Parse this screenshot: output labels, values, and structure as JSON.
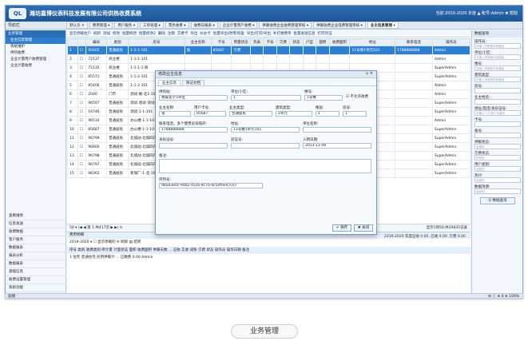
{
  "app": {
    "logo_text": "QL",
    "title": "潍坊嘉博仪表科技发展有限公司供热收费系统",
    "user_info": "当前:2019-2020 年度  ▲ 帐号:Admin  ✖ 帮助"
  },
  "menubar": {
    "left_label": "导航栏",
    "tabs": [
      {
        "label": "默认页 ✕"
      },
      {
        "label": "费用管理 ▾"
      },
      {
        "label": "用户服务 ▾"
      },
      {
        "label": "工单处理 ▾"
      },
      {
        "label": "票务收费 ▾"
      },
      {
        "label": "收费日报表 ▾"
      },
      {
        "label": "企业计量用户收费 ▾"
      },
      {
        "label": "供暖收费企业收费管理审核 ▾"
      },
      {
        "label": "供暖收费企业电费管理审核 ▾"
      },
      {
        "label": "业主信息管理 ▾"
      }
    ]
  },
  "sidebar": {
    "header": "业务管理",
    "items": [
      {
        "label": "业主信息管理"
      },
      {
        "label": "系统维护"
      },
      {
        "label": "供热收费"
      },
      {
        "label": "企业计量用户收费管理"
      },
      {
        "label": "企业计量收费"
      }
    ],
    "bottom_items": [
      {
        "label": "查看维修"
      },
      {
        "label": "信息发送"
      },
      {
        "label": "收费数据"
      },
      {
        "label": "客户服务"
      },
      {
        "label": "数据报表"
      },
      {
        "label": "报表分析"
      },
      {
        "label": "数据报表"
      },
      {
        "label": "基础信息"
      },
      {
        "label": "收费设置管理"
      },
      {
        "label": "系统功能"
      }
    ]
  },
  "toolbar": {
    "buttons": [
      "显示停暖住户",
      "刷新",
      "添加",
      "修改",
      "批量修改",
      "批量修改2",
      "删除",
      "注销",
      "交费卡",
      "导出",
      "补办卡",
      "批量导出/改用/恢复",
      "导出/打印/导出",
      "补打缴费单",
      "批量发短信息",
      "打印凭证"
    ]
  },
  "grid": {
    "columns": [
      "",
      "",
      "编号",
      "类别",
      "房号",
      "业主名称",
      "卡号",
      "用量状态",
      "热表",
      "卡号",
      "欠费",
      "状态",
      "户型",
      "面积",
      "收费面积",
      "地址",
      "联系电话",
      "操作员"
    ],
    "rows": [
      {
        "n": "1",
        "code": "95605",
        "type": "普通居民",
        "room": "1-1-1-101",
        "name": "张",
        "card": "85687",
        "state": "欠费",
        "debt": "",
        "phone": "1788888888",
        "op": "Admin",
        "addr": "11号楼1单元101",
        "selected": true
      },
      {
        "n": "2",
        "code": "72137",
        "type": "商业楼",
        "room": "1-1-1-101",
        "name": "",
        "card": "",
        "state": "",
        "debt": "",
        "phone": "",
        "op": "Admin",
        "addr": ""
      },
      {
        "n": "3",
        "code": "72135",
        "type": "商业楼",
        "room": "1-1-1-1-商",
        "name": "",
        "card": "",
        "state": "",
        "debt": "",
        "phone": "",
        "op": "SuperAdmin",
        "addr": ""
      },
      {
        "n": "4",
        "code": "85571",
        "type": "普通居民",
        "room": "1-1-2-101",
        "name": "",
        "card": "",
        "state": "",
        "debt": "",
        "phone": "",
        "op": "SuperAdmin",
        "addr": ""
      },
      {
        "n": "5",
        "code": "85406",
        "type": "普通居民",
        "room": "1-1-2-101",
        "name": "",
        "card": "",
        "state": "",
        "debt": "",
        "phone": "",
        "op": "Admin",
        "addr": ""
      },
      {
        "n": "6",
        "code": "2040",
        "type": "门市",
        "room": "测试-敏-北1-102",
        "name": "",
        "card": "",
        "state": "",
        "debt": "",
        "phone": "",
        "op": "Admin",
        "addr": ""
      },
      {
        "n": "7",
        "code": "96597",
        "type": "普通居民",
        "room": "测试-测试-测试-101",
        "name": "",
        "card": "",
        "state": "",
        "debt": "",
        "phone": "",
        "op": "SuperAdmin",
        "addr": ""
      },
      {
        "n": "8",
        "code": "16746",
        "type": "普通居民",
        "room": "测试-1-1-101",
        "name": "",
        "card": "",
        "state": "",
        "debt": "",
        "phone": "",
        "op": "SuperAdmin",
        "addr": ""
      },
      {
        "n": "9",
        "code": "96510",
        "type": "普通居民",
        "room": "办公楼-1-1-101",
        "name": "",
        "card": "",
        "state": "",
        "debt": "",
        "phone": "",
        "op": "Admin",
        "addr": ""
      },
      {
        "n": "10",
        "code": "85687",
        "type": "普通居民",
        "room": "办公楼-1-1-101",
        "name": "",
        "card": "",
        "state": "",
        "debt": "",
        "phone": "",
        "op": "SuperAdmin",
        "addr": ""
      },
      {
        "n": "11",
        "code": "96799",
        "type": "普通居民",
        "room": "北城站-北城四产-0-101",
        "name": "",
        "card": "",
        "state": "",
        "debt": "",
        "phone": "",
        "op": "SuperAdmin",
        "addr": ""
      },
      {
        "n": "12",
        "code": "96800",
        "type": "普通居民",
        "room": "北城站-北城四产-0-101",
        "name": "",
        "card": "",
        "state": "",
        "debt": "",
        "phone": "",
        "op": "SuperAdmin",
        "addr": ""
      },
      {
        "n": "13",
        "code": "96798",
        "type": "普通居民",
        "room": "北城站-北城四产-0-101",
        "name": "",
        "card": "",
        "state": "",
        "debt": "",
        "phone": "",
        "op": "SuperAdmin",
        "addr": ""
      },
      {
        "n": "14",
        "code": "96797",
        "type": "普通居民",
        "room": "北城站-北城四产-0-201",
        "name": "",
        "card": "",
        "state": "",
        "debt": "",
        "phone": "",
        "op": "SuperAdmin",
        "addr": ""
      },
      {
        "n": "15",
        "code": "98362",
        "type": "普通居民",
        "room": "新城厂-1-北-101",
        "name": "",
        "card": "",
        "state": "",
        "debt": "",
        "phone": "",
        "op": "SuperAdmin",
        "addr": ""
      }
    ]
  },
  "pager": {
    "text": "50 ▾  |◀  ◀  第 1  共417页  ▶  ▶|  ↻",
    "info": "显示1到50,共20835记录"
  },
  "lower": {
    "header": "费用明细",
    "filter": "2019-2020 ▾   ☐ 显示停暖的 ⟳ 刷新 ▤ 结转",
    "cols": "序号  类别  收费类别  所计量  计量状态  面积  收费面积  供暖天数  ...  应收   实收  减免  欠费  状态  操作员  操作日期  备注",
    "row": "1  住宅  普通住宅  民用供暖计  ...  已缴费  0.00  Admin",
    "status": "2019-2020 年度应收 0.00 ,已收 0.00 ,欠费 0.00"
  },
  "right": {
    "header": "数据查询",
    "fields": [
      {
        "label": "操作员:",
        "placeholder": "可输入拼音首字母搜索"
      },
      {
        "label": "单位/小区:",
        "placeholder": "可输入拼音首字母搜索"
      },
      {
        "label": "楼号:",
        "placeholder": "可输入拼音首字母搜索"
      },
      {
        "label": "建筑类型:",
        "placeholder": "可输入拼音首字母搜索"
      },
      {
        "label": "房号:",
        "placeholder": ""
      },
      {
        "label": "业主姓名:",
        "placeholder": ""
      },
      {
        "label": "地址/电话/身份证号:",
        "placeholder": "可输入一个/多个关键字"
      },
      {
        "label": "卡号:",
        "placeholder": ""
      },
      {
        "label": "备号:",
        "placeholder": ""
      },
      {
        "label": "供暖状态:",
        "placeholder": "全部的"
      },
      {
        "label": "欠费状态:",
        "placeholder": "所有的"
      },
      {
        "label": "用户类别:",
        "placeholder": "全部的"
      },
      {
        "label": "热计:",
        "placeholder": "全部的"
      },
      {
        "label": "数据持源:",
        "placeholder": "全部的"
      }
    ],
    "search_button": "Q 数据查询"
  },
  "dialog": {
    "title": "修改业主信息",
    "tabs": [
      "业主信息",
      "附记文档"
    ],
    "fields": {
      "dept_label": "供热站:",
      "dept_value": "德威化学1单位",
      "community_label": "单位/小区:",
      "community_value": "1",
      "building_label": "楼号:",
      "building_value": "1号楼",
      "stop_label": "☑ 不允许收费",
      "owner_label": "业主名称:",
      "owner_value": "张",
      "user_label": "用户卡号:",
      "user_value": "85687",
      "type_label": "业主类型:",
      "type_value": "普通居民",
      "btype_label": "建筑类型:",
      "btype_value": "1单元",
      "floor_label": "楼层:",
      "floor_value": "1",
      "room_label": "房号:",
      "room_value": "1",
      "phone_label": "联系电话，多个使用逗号隔开:",
      "phone_value": "1788888888",
      "addr_label": "地址:",
      "addr_value": "11号楼1单元101",
      "unit_label": "单位名称:",
      "unit_value": "",
      "id_label": "身份证号:",
      "id_value": "",
      "cert_label": "房证号:",
      "cert_value": "",
      "date_label": "入网日期:",
      "date_value": "2013-11-08",
      "remark_label": "备注:",
      "remark_value": "",
      "serial_label": "序列号:",
      "serial_value": "9ba43e0c-9dd2-45cb-9c70-dc5df0e47ce7"
    },
    "save_label": "✔ 保存",
    "close_label": "✖ 关闭"
  },
  "statusbar": {
    "left": "就绪",
    "right": "⚙ ⓘ  ⊕ 0  ⊕ 100%"
  },
  "caption": "业务管理"
}
